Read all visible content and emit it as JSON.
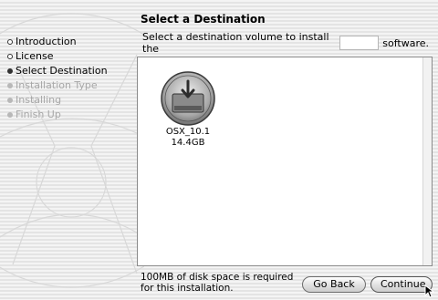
{
  "window": {
    "pane_title": "Select a Destination"
  },
  "sidebar": {
    "steps": [
      {
        "label": "Introduction",
        "state": "done"
      },
      {
        "label": "License",
        "state": "done"
      },
      {
        "label": "Select Destination",
        "state": "current"
      },
      {
        "label": "Installation Type",
        "state": "todo"
      },
      {
        "label": "Installing",
        "state": "todo"
      },
      {
        "label": "Finish Up",
        "state": "todo"
      }
    ]
  },
  "main": {
    "instruction_before": "Select a destination volume to install the",
    "instruction_after": "software.",
    "volume": {
      "name": "OSX_10.1",
      "size": "14.4GB",
      "icon": "hard-drive-icon"
    }
  },
  "footer": {
    "status_line1": "100MB of disk space is required",
    "status_line2": "for this installation.",
    "go_back_label": "Go Back",
    "continue_label": "Continue"
  },
  "colors": {
    "window_stripe_light": "#f4f4f4",
    "window_stripe_dark": "#e4e4e4",
    "panel_bg": "#ffffff"
  },
  "icons": {
    "step_done": "hollow-bullet-icon",
    "step_current": "filled-bullet-icon",
    "step_todo": "gray-bullet-icon",
    "cursor": "arrow-cursor-icon"
  }
}
